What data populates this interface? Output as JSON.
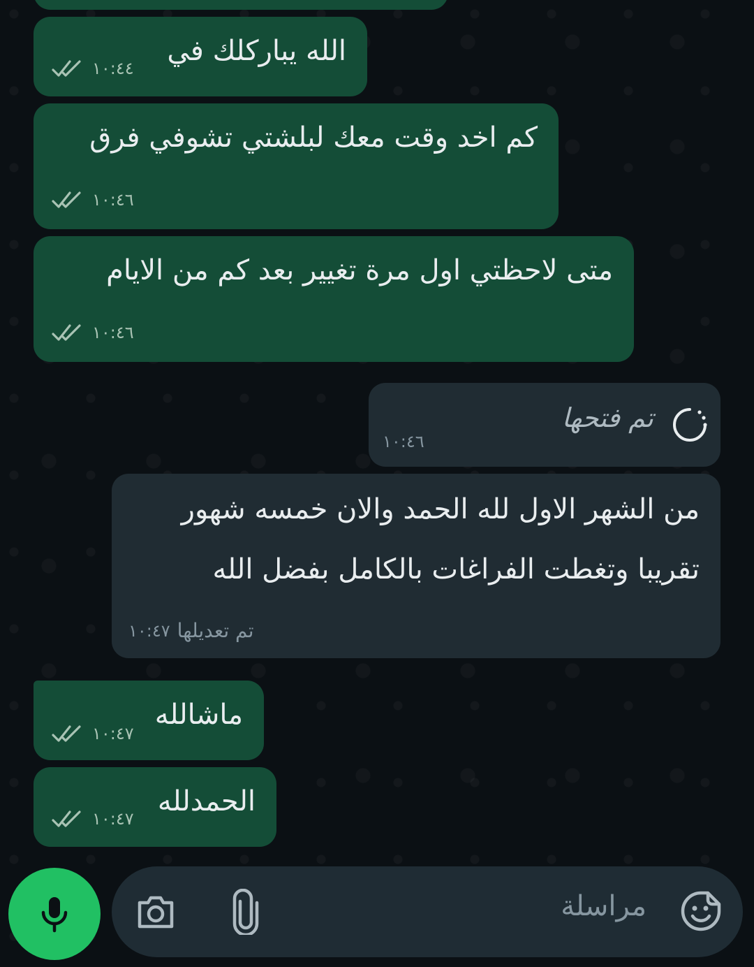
{
  "messages": [
    {
      "text": "الله يباركلك في",
      "time": "١٠:٤٤",
      "direction": "out",
      "status": "read"
    },
    {
      "text": "كم اخد وقت معك لبلشتي تشوفي فرق",
      "time": "١٠:٤٦",
      "direction": "out",
      "status": "read"
    },
    {
      "text": "متى لاحظتي اول مرة تغيير بعد كم من الايام",
      "time": "١٠:٤٦",
      "direction": "out",
      "status": "read"
    },
    {
      "text": "تم فتحها",
      "time": "١٠:٤٦",
      "direction": "in",
      "kind": "view-once-opened"
    },
    {
      "line1": "من الشهر الاول لله الحمد والان خمسه شهور",
      "line2": "تقريبا وتغطت الفراغات بالكامل بفضل الله",
      "edited_label": "تم تعديلها",
      "time": "١٠:٤٧",
      "direction": "in"
    },
    {
      "text": "ماشالله",
      "time": "١٠:٤٧",
      "direction": "out",
      "status": "read"
    },
    {
      "text": "الحمدلله",
      "time": "١٠:٤٧",
      "direction": "out",
      "status": "read"
    }
  ],
  "composer": {
    "placeholder": "مراسلة",
    "icons": [
      "sticker-icon",
      "attach-icon",
      "camera-icon",
      "mic-icon"
    ]
  },
  "colors": {
    "background": "#0b1014",
    "outgoing_bubble": "#144d37",
    "incoming_bubble": "#202c33",
    "read_ticks": "#a9c3b4",
    "mic_button": "#21c063"
  }
}
